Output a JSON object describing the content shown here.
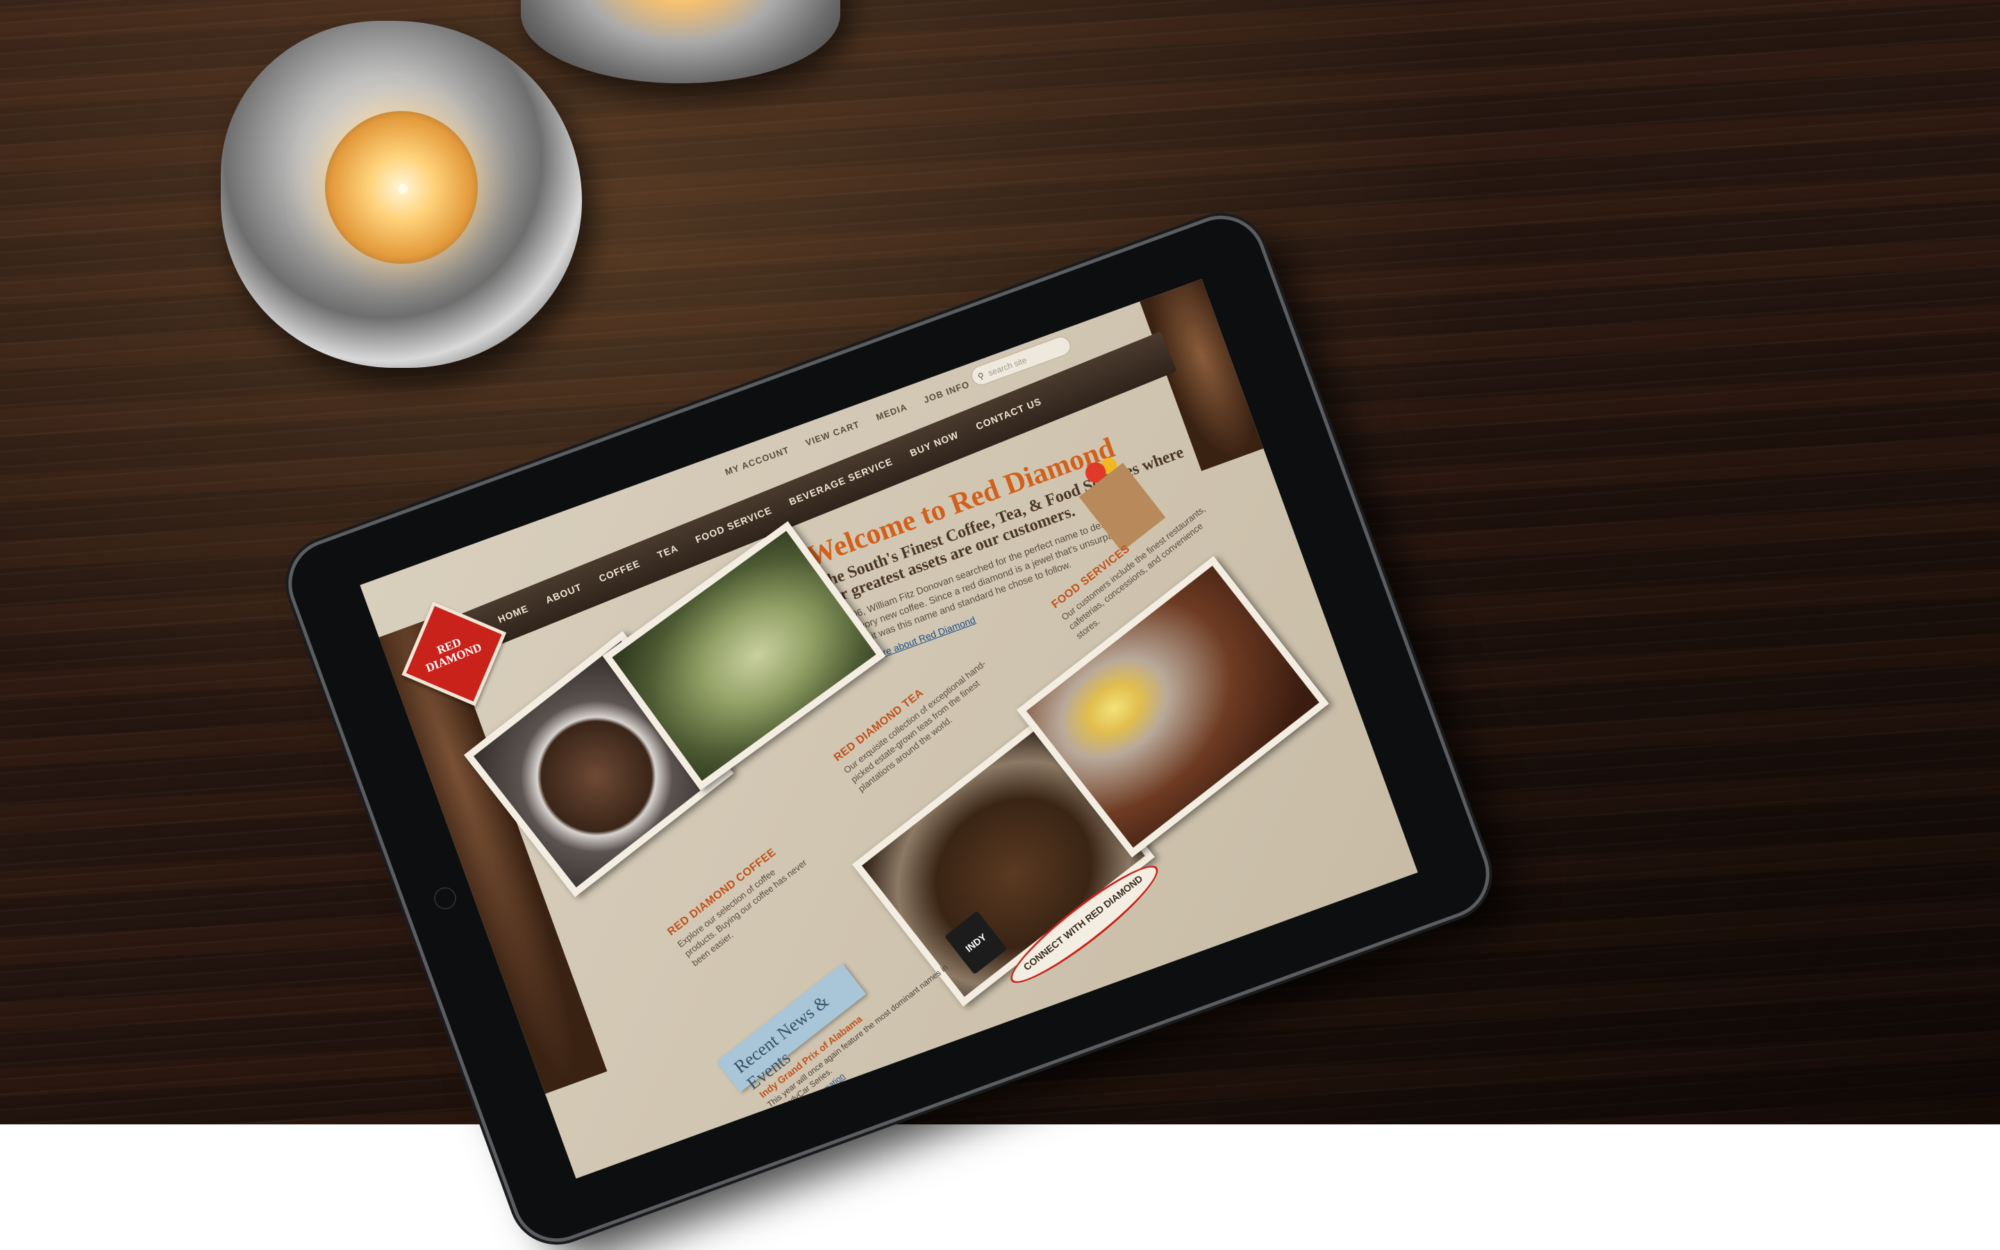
{
  "site": {
    "utils": [
      "MY ACCOUNT",
      "VIEW CART",
      "MEDIA",
      "JOB INFO"
    ],
    "search_placeholder": "search site",
    "logo": "RED DIAMOND",
    "nav": [
      "HOME",
      "ABOUT",
      "COFFEE",
      "TEA",
      "FOOD SERVICE",
      "BEVERAGE SERVICE",
      "BUY NOW",
      "CONTACT US"
    ],
    "welcome_title": "Welcome to Red Diamond",
    "welcome_subtitle": "The South's Finest Coffee, Tea, & Food Services where our greatest assets are our customers.",
    "welcome_body": "In 1906, William Fitz Donovan searched for the perfect name to describe his savory new coffee. Since a red diamond is a jewel that's unsurpassed in quality, it was this name and standard he chose to follow.",
    "welcome_link": "learn more about Red Diamond",
    "food_title": "FOOD SERVICES",
    "food_body": "Our customers include the finest restaurants, cafeterias, concessions, and convenience stores.",
    "tea_title": "RED DIAMOND TEA",
    "tea_body": "Our exquisite collection of exceptional hand-picked estate-grown teas from the finest plantations around the world.",
    "coffee_title": "RED DIAMOND COFFEE",
    "coffee_body": "Explore our selection of coffee products. Buying our coffee has never been easier.",
    "news_tag": "Recent News & Events",
    "news_headline": "Indy Grand Prix of Alabama",
    "news_body": "This year will once again feature the most dominant names in the IndyCar Series.",
    "news_link": "see more information",
    "indy_badge": "INDY",
    "connect": "CONNECT WITH RED DIAMOND"
  }
}
